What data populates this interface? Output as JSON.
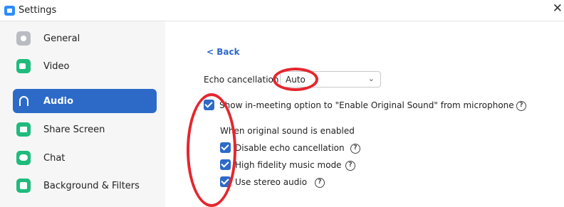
{
  "window": {
    "title": "Settings",
    "close_glyph": "✕"
  },
  "sidebar": {
    "items": [
      {
        "label": "General",
        "icon": "gear-icon",
        "active": false
      },
      {
        "label": "Video",
        "icon": "video-camera-icon",
        "active": false
      },
      {
        "label": "Audio",
        "icon": "headphones-icon",
        "active": true
      },
      {
        "label": "Share Screen",
        "icon": "share-screen-icon",
        "active": false
      },
      {
        "label": "Chat",
        "icon": "chat-bubble-icon",
        "active": false
      },
      {
        "label": "Background & Filters",
        "icon": "background-filters-icon",
        "active": false
      }
    ]
  },
  "audio": {
    "back_label": "< Back",
    "echo_cancellation": {
      "label": "Echo cancellation",
      "value": "Auto"
    },
    "show_original_sound": {
      "label": "Show in-meeting option to \"Enable Original Sound\" from microphone",
      "checked": true
    },
    "original_sound_heading": "When original sound is enabled",
    "options": [
      {
        "label": "Disable echo cancellation",
        "checked": true
      },
      {
        "label": "High fidelity music mode",
        "checked": true
      },
      {
        "label": "Use stereo audio",
        "checked": true
      }
    ],
    "help_glyph": "?"
  },
  "colors": {
    "accent": "#2d6ac7",
    "annotation": "#e5262e",
    "green_icon": "#1fbb7c",
    "gray_icon": "#b9bcc2"
  }
}
